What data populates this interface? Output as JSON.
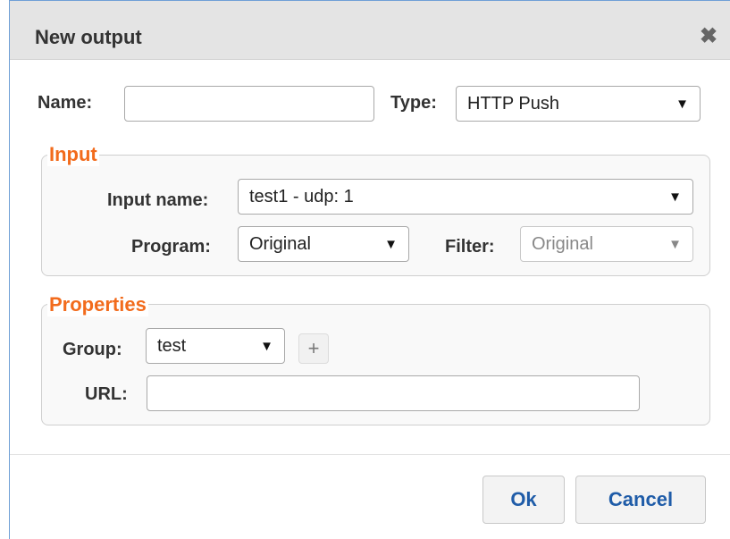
{
  "dialog": {
    "title": "New output",
    "close_glyph": "✖"
  },
  "name_field": {
    "label": "Name:",
    "value": "",
    "placeholder": ""
  },
  "type_field": {
    "label": "Type:",
    "selected": "HTTP Push"
  },
  "input_section": {
    "legend": "Input",
    "input_name": {
      "label": "Input name:",
      "selected": "test1 - udp: 1"
    },
    "program": {
      "label": "Program:",
      "selected": "Original"
    },
    "filter": {
      "label": "Filter:",
      "selected": "Original",
      "disabled": true
    }
  },
  "properties_section": {
    "legend": "Properties",
    "group": {
      "label": "Group:",
      "selected": "test",
      "add_glyph": "+"
    },
    "url": {
      "label": "URL:",
      "value": "",
      "placeholder": ""
    }
  },
  "buttons": {
    "ok": "Ok",
    "cancel": "Cancel"
  },
  "icons": {
    "close": "close-icon",
    "dropdown": "chevron-down-icon",
    "add": "plus-icon"
  },
  "colors": {
    "legend": "#f26b1c",
    "button_text": "#1f5ca8",
    "dialog_border": "#6f9fd6"
  }
}
